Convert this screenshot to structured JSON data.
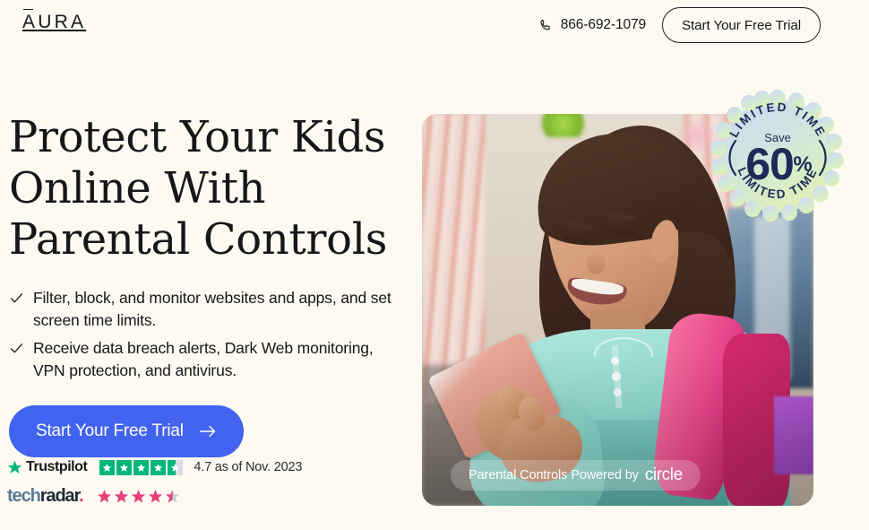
{
  "brand": {
    "logo_text": "AURA",
    "accent_blue": "#4263f0",
    "page_background": "#fdfaf2"
  },
  "header": {
    "phone": {
      "icon": "phone-icon",
      "number": "866-692-1079"
    },
    "cta_label": "Start Your Free Trial"
  },
  "hero": {
    "headline_lines": [
      "Protect Your Kids",
      "Online With",
      "Parental Controls"
    ],
    "bullets": [
      "Filter, block, and monitor websites and apps, and set screen time limits.",
      "Receive data breach alerts, Dark Web monitoring, VPN protection, and antivirus."
    ],
    "cta_label": "Start Your Free Trial",
    "cta_icon": "arrow-right-icon"
  },
  "reviews": {
    "trustpilot": {
      "name": "Trustpilot",
      "stars_filled": 4.5,
      "stars_total": 5,
      "rating_text": "4.7 as of Nov. 2023",
      "star_color": "#00b67a"
    },
    "techradar": {
      "name_part1": "tech",
      "name_part2": "radar",
      "name_dot": ".",
      "stars_filled": 4.5,
      "stars_total": 5,
      "star_color": "#e8407a"
    }
  },
  "photo": {
    "alt": "Smiling girl with pink backpack looking at a phone",
    "caption_text": "Parental Controls Powered by",
    "caption_brand": "circle"
  },
  "badge": {
    "arc_top_text": "LIMITED TIME",
    "arc_bottom_text": "LIMITED TIME",
    "save_label": "Save",
    "discount_number": "60",
    "discount_unit": "%",
    "text_color": "#1e2a57"
  }
}
